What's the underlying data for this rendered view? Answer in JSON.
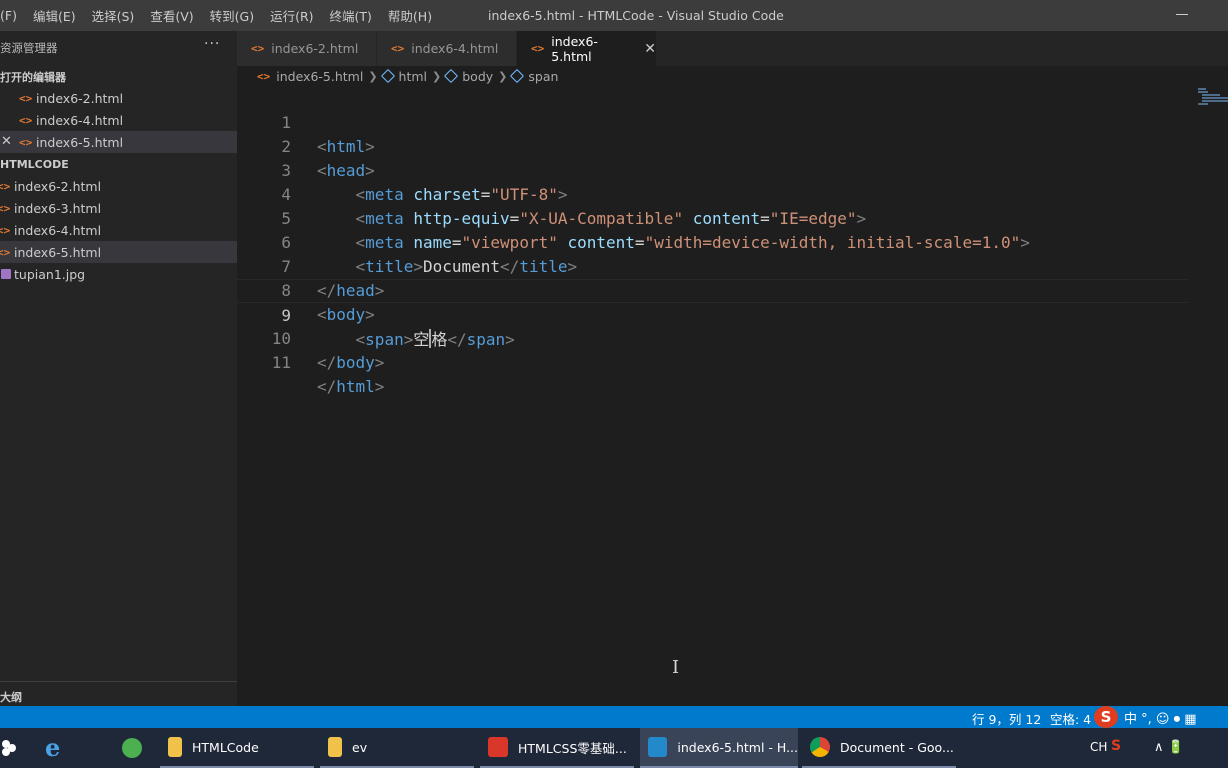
{
  "window": {
    "title": "index6-5.html - HTMLCode - Visual Studio Code"
  },
  "menu": [
    {
      "label": "(F)"
    },
    {
      "label": "编辑(E)"
    },
    {
      "label": "选择(S)"
    },
    {
      "label": "查看(V)"
    },
    {
      "label": "转到(G)"
    },
    {
      "label": "运行(R)"
    },
    {
      "label": "终端(T)"
    },
    {
      "label": "帮助(H)"
    }
  ],
  "sidebar": {
    "title": "资源管理器",
    "more_label": "···",
    "open_editors_title": "打开的编辑器",
    "open_editors": [
      {
        "label": "index6-2.html"
      },
      {
        "label": "index6-4.html"
      },
      {
        "label": "index6-5.html"
      }
    ],
    "folder_title": "HTMLCODE",
    "files": [
      {
        "label": "index6-2.html"
      },
      {
        "label": "index6-3.html"
      },
      {
        "label": "index6-4.html"
      },
      {
        "label": "index6-5.html"
      },
      {
        "label": "tupian1.jpg"
      }
    ],
    "outline_title": "大纲",
    "file_icon_glyph": "<>",
    "close_glyph": "✕"
  },
  "tabs": [
    {
      "label": "index6-2.html"
    },
    {
      "label": "index6-4.html"
    },
    {
      "label": "index6-5.html",
      "close": "✕"
    }
  ],
  "breadcrumb": {
    "file": "index6-5.html",
    "items": [
      "html",
      "body",
      "span"
    ]
  },
  "editor": {
    "line_numbers": [
      "1",
      "2",
      "3",
      "4",
      "5",
      "6",
      "7",
      "8",
      "9",
      "10",
      "11"
    ],
    "current_line": 9,
    "code": {
      "l1": {
        "tag": "html"
      },
      "l2": {
        "tag": "head"
      },
      "l3": {
        "tag": "meta",
        "attr": "charset",
        "val": "\"UTF-8\""
      },
      "l4": {
        "tag": "meta",
        "attr1": "http-equiv",
        "val1": "\"X-UA-Compatible\"",
        "attr2": "content",
        "val2": "\"IE=edge\""
      },
      "l5": {
        "tag": "meta",
        "attr1": "name",
        "val1": "\"viewport\"",
        "attr2": "content",
        "val2": "\"width=device-width, initial-scale=1.0\""
      },
      "l6": {
        "tag": "title",
        "text": "Document"
      },
      "l7": {
        "tag": "head"
      },
      "l8": {
        "tag": "body"
      },
      "l9": {
        "tag": "span",
        "text_before": "空",
        "text_after": "格"
      },
      "l10": {
        "tag": "body"
      },
      "l11": {
        "tag": "html"
      }
    }
  },
  "statusbar": {
    "position": "行 9，列 12",
    "indent": "空格: 4",
    "ime_logo": "S",
    "ime_tools": "中 °, ☺ ⏺ ▦"
  },
  "taskbar": {
    "apps": [
      {
        "label": "HTMLCode"
      },
      {
        "label": "ev"
      },
      {
        "label": "HTMLCSS零基础..."
      },
      {
        "label": "index6-5.html - H..."
      },
      {
        "label": "Document - Goo..."
      }
    ],
    "tray_lang": "CH",
    "tray_ime": "S",
    "tray_icons": "∧ 🔋"
  },
  "colors": {
    "accent": "#007acc",
    "tag": "#569cd6",
    "attribute": "#9cdcfe",
    "string": "#ce9178",
    "file_icon": "#e37933"
  }
}
